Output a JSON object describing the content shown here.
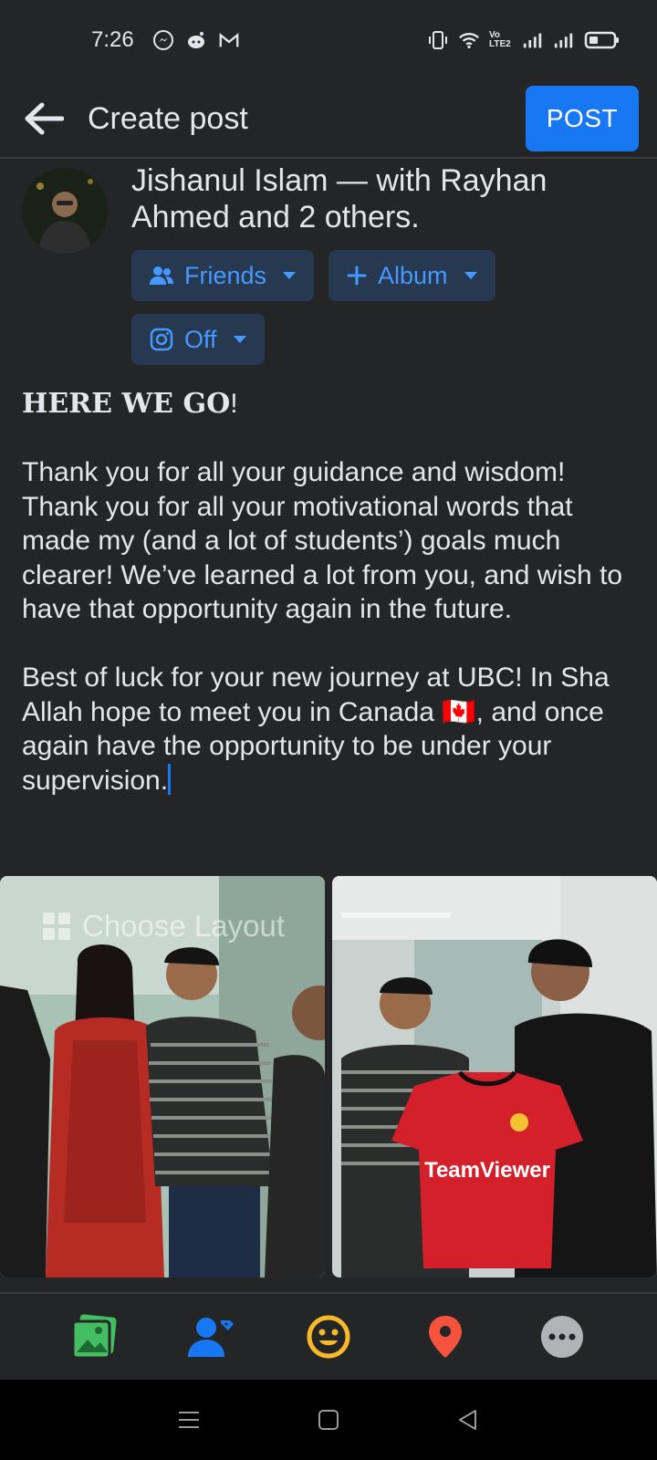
{
  "status_bar": {
    "time": "7:26",
    "left_icons": [
      "messenger-icon",
      "reddit-icon",
      "gmail-icon"
    ],
    "right_icons": [
      "vibrate-icon",
      "wifi-icon",
      "volte-icon",
      "signal-1-icon",
      "signal-2-icon",
      "battery-icon"
    ],
    "volte_label": "Vo LTE2"
  },
  "header": {
    "title": "Create post",
    "post_label": "POST",
    "accent": "#1877f2"
  },
  "author": {
    "line": "Jishanul Islam — with Rayhan Ahmed and 2 others."
  },
  "chips": {
    "audience": "Friends",
    "album": "Album",
    "instagram": "Off"
  },
  "post": {
    "heading": "HERE WE GO",
    "heading_suffix": "!",
    "paragraph1": "Thank you for all your guidance and wisdom! Thank you for all your motivational words that made my (and a lot of students’) goals much clearer! We’ve learned a lot from you, and wish to have that opportunity again in the future.",
    "paragraph2": "Best of luck for your new journey at UBC! In Sha Allah hope to meet you in Canada 🇨🇦, and once again have the opportunity to be under your supervision."
  },
  "photos": {
    "choose_layout": "Choose Layout",
    "shirt_text": "TeamViewer"
  },
  "toolbar": {
    "items": [
      "photo-icon",
      "tag-people-icon",
      "feeling-icon",
      "location-icon",
      "more-icon"
    ]
  },
  "navbar": {
    "items": [
      "menu-icon",
      "home-icon",
      "back-icon"
    ]
  }
}
